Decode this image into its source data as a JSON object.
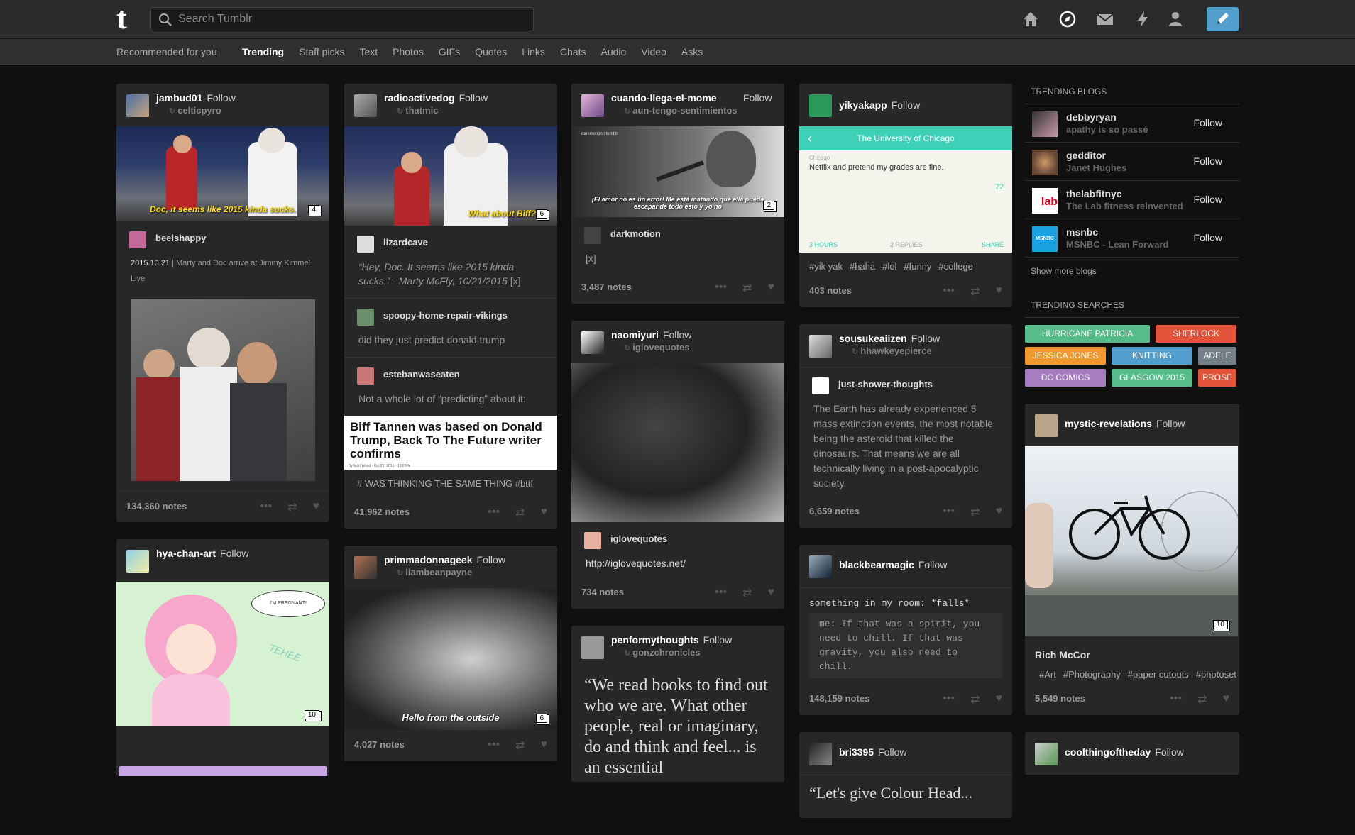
{
  "search": {
    "placeholder": "Search Tumblr"
  },
  "subnav": {
    "recommended": "Recommended for you",
    "tabs": [
      "Trending",
      "Staff picks",
      "Text",
      "Photos",
      "GIFs",
      "Quotes",
      "Links",
      "Chats",
      "Audio",
      "Video",
      "Asks"
    ]
  },
  "follow": "Follow",
  "col1": {
    "p1": {
      "user": "jambud01",
      "reblog": "celticpyro",
      "caption": "Doc, it seems like 2015 kinda sucks.",
      "badge": "4",
      "sub": "beeishappy",
      "date": "2015.10.21",
      "desc": "| Marty and Doc arrive at Jimmy Kimmel Live",
      "notes": "134,360 notes"
    },
    "p2": {
      "user": "hya-chan-art",
      "bubble": "I'M PREGNANT!",
      "sfx": "TEHEE",
      "badge": "10"
    }
  },
  "col2": {
    "p1": {
      "user": "radioactivedog",
      "reblog": "thatmic",
      "caption": "What about Biff?",
      "badge": "6",
      "sub1": "lizardcave",
      "quote": "“Hey, Doc. It seems like 2015 kinda sucks.” - Marty McFly, 10/21/2015",
      "qlink": "[x]",
      "sub2": "spoopy-home-repair-vikings",
      "t2": "did they just predict donald trump",
      "sub3": "estebanwaseaten",
      "t3": "Not a whole lot of “predicting” about it:",
      "headline": "Biff Tannen was based on Donald Trump, Back To The Future writer confirms",
      "byline": "By Matt Wood · Oct 22, 2015 · 1:00 PM",
      "tags": "# WAS THINKING THE SAME THING  #bttf",
      "notes": "41,962 notes"
    },
    "p2": {
      "user": "primmadonnageek",
      "reblog": "liambeanpayne",
      "caption": "Hello from the outside",
      "badge": "6",
      "notes": "4,027 notes"
    }
  },
  "col3": {
    "p1": {
      "user": "cuando-llega-el-mome",
      "reblog": "aun-tengo-sentimientos",
      "wm": "darkmotion | tumblr",
      "caption": "¡El amor no es un error! Me está matando que ella pueda escapar de todo esto y yo no",
      "badge": "2",
      "sub": "darkmotion",
      "t": "[x]",
      "notes": "3,487 notes"
    },
    "p2": {
      "user": "naomiyuri",
      "reblog": "iglovequotes",
      "sub": "iglovequotes",
      "link": "http://iglovequotes.net/",
      "notes": "734 notes"
    },
    "p3": {
      "user": "penformythoughts",
      "reblog": "gonzchronicles",
      "quote": "“We read books to find out who we are. What other people, real or imaginary, do and think and feel... is an essential"
    }
  },
  "col4": {
    "p1": {
      "user": "yikyakapp",
      "bar": "The University of Chicago",
      "loc": "Chicago",
      "msg": "Netflix and pretend my grades are fine.",
      "votes": "72",
      "hours": "3 HOURS",
      "replies": "2 REPLIES",
      "share": "SHARE",
      "tags": [
        "#yik yak",
        "#haha",
        "#lol",
        "#funny",
        "#college"
      ],
      "notes": "403 notes"
    },
    "p2": {
      "user": "sousukeaiizen",
      "reblog": "hhawkeyepierce",
      "sub": "just-shower-thoughts",
      "t": "The Earth has already experienced 5 mass extinction events, the most notable being the asteroid that killed the dinosaurs. That means we are all technically living in a post-apocalyptic society.",
      "notes": "6,659 notes"
    },
    "p3": {
      "user": "blackbearmagic",
      "title": "something in my room: *falls*",
      "chat": "me: If that was a spirit, you need to chill. If that was gravity, you also need to chill.",
      "notes": "148,159 notes"
    },
    "p4": {
      "user": "bri3395",
      "quote": "“Let's give Colour Head..."
    }
  },
  "sidebar": {
    "blogs_title": "TRENDING BLOGS",
    "blogs": [
      {
        "name": "debbyryan",
        "title": "apathy is so passé"
      },
      {
        "name": "gedditor",
        "title": "Janet Hughes"
      },
      {
        "name": "thelabfitnyc",
        "title": "The Lab fitness reinvented"
      },
      {
        "name": "msnbc",
        "title": "MSNBC - Lean Forward"
      }
    ],
    "more": "Show more blogs",
    "searches_title": "TRENDING SEARCHES",
    "searches": [
      "HURRICANE PATRICIA",
      "SHERLOCK",
      "JESSICA JONES",
      "KNITTING",
      "ADELE",
      "DC COMICS",
      "GLASGOW 2015",
      "PROSE"
    ],
    "post": {
      "user": "mystic-revelations",
      "badge": "10",
      "sub": "Rich McCor",
      "tags": [
        "#Art",
        "#Photography",
        "#paper cutouts",
        "#photoset"
      ],
      "notes": "5,549 notes"
    },
    "post2": {
      "user": "coolthingoftheday"
    }
  },
  "colors": {
    "accent": "#529ecc",
    "bg": "#101010",
    "card": "#272727",
    "yik": "#3fd0b8"
  }
}
